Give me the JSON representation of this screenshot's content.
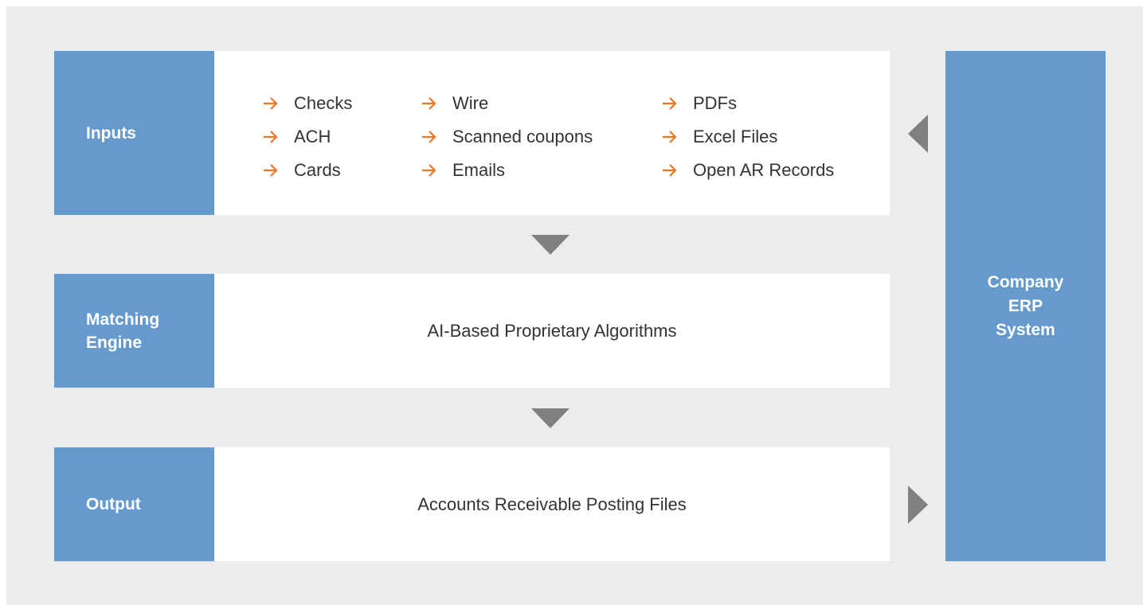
{
  "inputs_label": "Inputs",
  "matching_engine_label": [
    "Matching",
    "Engine"
  ],
  "output_label": "Output",
  "erp_label": [
    "Company",
    "ERP",
    "System"
  ],
  "input_columns": [
    [
      "Checks",
      "ACH",
      "Cards"
    ],
    [
      "Wire",
      "Scanned coupons",
      "Emails"
    ],
    [
      "PDFs",
      "Excel Files",
      "Open AR Records"
    ]
  ],
  "matching_engine_text": "AI-Based Proprietary Algorithms",
  "output_text": "Accounts Receivable Posting Files",
  "colors": {
    "background": "#ececec",
    "label_fill": "#6699cc",
    "content_fill": "#ffffff",
    "arrow_accent": "#ee7623",
    "connector": "#808080"
  },
  "icons": {
    "input_bullet": "arrow-right-icon",
    "flow_down": "triangle-down-icon",
    "erp_to_inputs": "triangle-left-icon",
    "output_to_erp": "triangle-right-icon"
  }
}
